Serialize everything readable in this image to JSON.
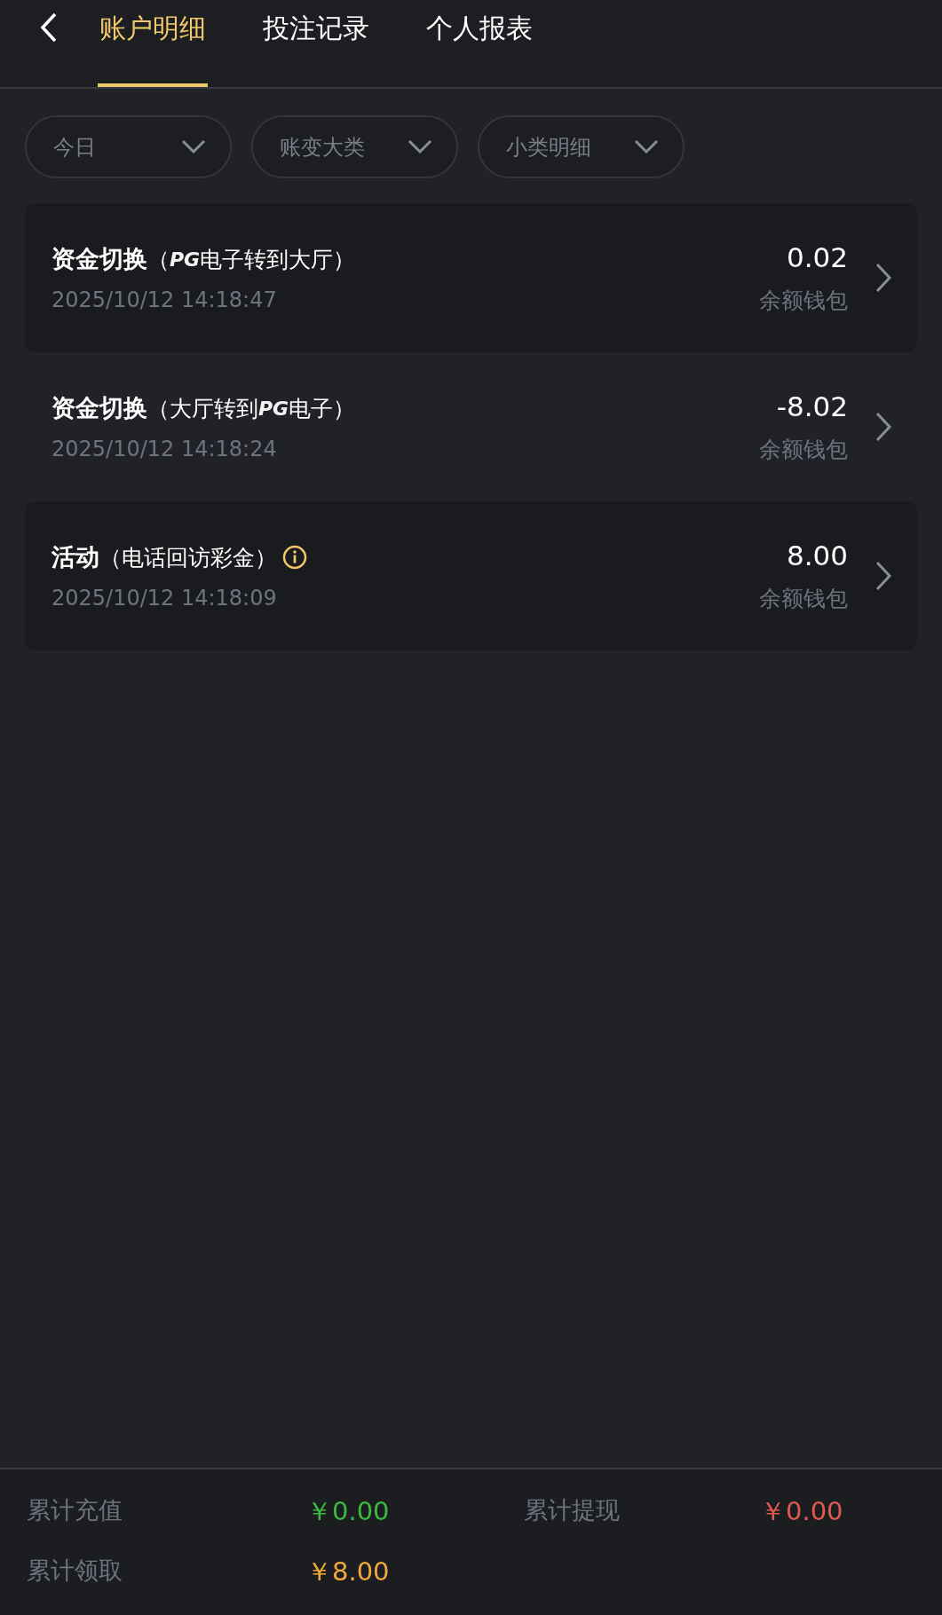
{
  "header": {
    "tabs": [
      {
        "label": "账户明细",
        "selected": true
      },
      {
        "label": "投注记录",
        "selected": false
      },
      {
        "label": "个人报表",
        "selected": false
      }
    ]
  },
  "filters": [
    {
      "label": "今日"
    },
    {
      "label": "账变大类"
    },
    {
      "label": "小类明细"
    }
  ],
  "records": [
    {
      "title": "资金切换",
      "detail": [
        {
          "kind": "text",
          "text": "（"
        },
        {
          "kind": "logo",
          "text": "PG"
        },
        {
          "kind": "text",
          "text": "电子转到大厅）"
        }
      ],
      "info": false,
      "time": "2025/10/12 14:18:47",
      "amount": "0.02",
      "wallet": "余额钱包"
    },
    {
      "title": "资金切换",
      "detail": [
        {
          "kind": "text",
          "text": "（大厅转到"
        },
        {
          "kind": "logo",
          "text": "PG"
        },
        {
          "kind": "text",
          "text": "电子）"
        }
      ],
      "info": false,
      "time": "2025/10/12 14:18:24",
      "amount": "-8.02",
      "wallet": "余额钱包"
    },
    {
      "title": "活动",
      "detail": [
        {
          "kind": "text",
          "text": "（电话回访彩金）"
        }
      ],
      "info": true,
      "time": "2025/10/12 14:18:09",
      "amount": "8.00",
      "wallet": "余额钱包"
    }
  ],
  "summary": [
    {
      "label": "累计充值",
      "value": "￥0.00",
      "color": "#3dbb3f"
    },
    {
      "label": "累计提现",
      "value": "￥0.00",
      "color": "#e25a4f"
    },
    {
      "label": "累计领取",
      "value": "￥8.00",
      "color": "#f2a93b"
    }
  ]
}
